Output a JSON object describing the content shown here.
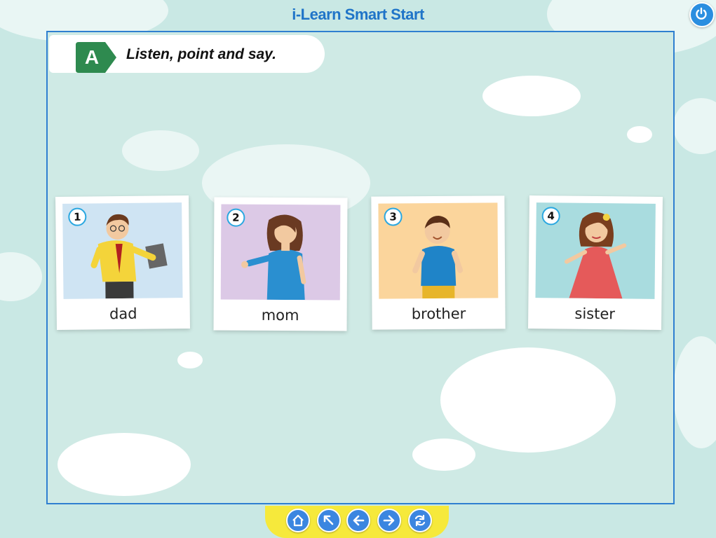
{
  "app": {
    "title": "i-Learn Smart Start"
  },
  "header": {
    "badge_letter": "A",
    "instruction": "Listen, point and say."
  },
  "cards": [
    {
      "number": "1",
      "word": "dad",
      "bg": "#cfe4f3",
      "icon": "dad-illustration"
    },
    {
      "number": "2",
      "word": "mom",
      "bg": "#dcc9e6",
      "icon": "mom-illustration"
    },
    {
      "number": "3",
      "word": "brother",
      "bg": "#fbd59c",
      "icon": "brother-illustration"
    },
    {
      "number": "4",
      "word": "sister",
      "bg": "#a9dcdf",
      "icon": "sister-illustration"
    }
  ],
  "nav": {
    "buttons": [
      "home-icon",
      "back-to-start-icon",
      "previous-icon",
      "next-icon",
      "refresh-icon"
    ]
  },
  "colors": {
    "title": "#1f74c8",
    "badge": "#2e8a4f",
    "nav_bar": "#f6e93b",
    "nav_button": "#3b86e0",
    "frame": "#2f7fd0"
  }
}
